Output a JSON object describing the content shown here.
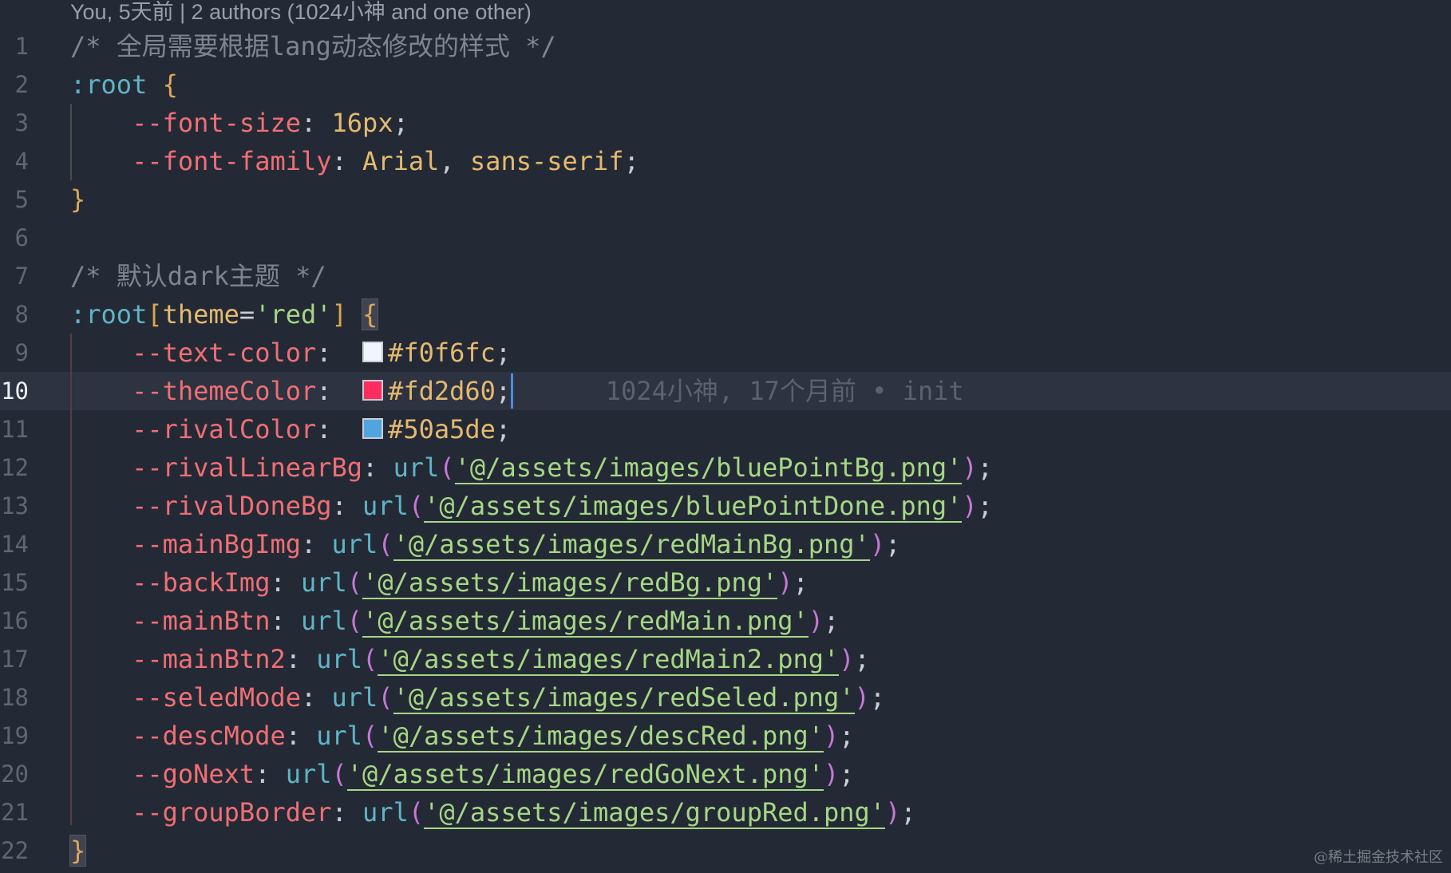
{
  "codelens": "You, 5天前 | 2 authors (1024小神 and one other)",
  "lines": [
    {
      "n": "1",
      "tokens": [
        {
          "t": "/* 全局需要根据lang动态修改的样式 */",
          "c": "com"
        }
      ]
    },
    {
      "n": "2",
      "tokens": [
        {
          "t": ":root",
          "c": "sel"
        },
        {
          "t": " ",
          "c": "op"
        },
        {
          "t": "{",
          "c": "brace"
        }
      ]
    },
    {
      "n": "3",
      "tokens": [
        {
          "t": "    ",
          "c": "op"
        },
        {
          "t": "--font-size",
          "c": "prop"
        },
        {
          "t": ": ",
          "c": "punct"
        },
        {
          "t": "16px",
          "c": "num"
        },
        {
          "t": ";",
          "c": "punct"
        }
      ]
    },
    {
      "n": "4",
      "tokens": [
        {
          "t": "    ",
          "c": "op"
        },
        {
          "t": "--font-family",
          "c": "prop"
        },
        {
          "t": ": ",
          "c": "punct"
        },
        {
          "t": "Arial",
          "c": "val"
        },
        {
          "t": ", ",
          "c": "punct"
        },
        {
          "t": "sans-serif",
          "c": "val"
        },
        {
          "t": ";",
          "c": "punct"
        }
      ]
    },
    {
      "n": "5",
      "tokens": [
        {
          "t": "}",
          "c": "brace"
        }
      ]
    },
    {
      "n": "6",
      "tokens": []
    },
    {
      "n": "7",
      "tokens": [
        {
          "t": "/* 默认dark主题 */",
          "c": "com"
        }
      ]
    },
    {
      "n": "8",
      "tokens": [
        {
          "t": ":root",
          "c": "sel"
        },
        {
          "t": "[",
          "c": "brk"
        },
        {
          "t": "theme",
          "c": "attr"
        },
        {
          "t": "=",
          "c": "op"
        },
        {
          "t": "'red'",
          "c": "str"
        },
        {
          "t": "]",
          "c": "brk"
        },
        {
          "t": " ",
          "c": "op"
        },
        {
          "t": "{",
          "c": "brace hlbrace"
        }
      ]
    },
    {
      "n": "9",
      "tokens": [
        {
          "t": "    ",
          "c": "op"
        },
        {
          "t": "--text-color",
          "c": "prop"
        },
        {
          "t": ":  ",
          "c": "punct"
        },
        {
          "swatch": "#f0f6fc"
        },
        {
          "t": "#f0f6fc",
          "c": "val"
        },
        {
          "t": ";",
          "c": "punct"
        }
      ]
    },
    {
      "n": "10",
      "current": true,
      "tokens": [
        {
          "t": "    ",
          "c": "op"
        },
        {
          "t": "--themeColor",
          "c": "prop"
        },
        {
          "t": ":  ",
          "c": "punct"
        },
        {
          "swatch": "#fd2d60"
        },
        {
          "t": "#fd2d60",
          "c": "val"
        },
        {
          "t": ";",
          "c": "punct"
        },
        {
          "cursor": true
        },
        {
          "t": "      1024小神, 17个月前 • init",
          "c": "blame"
        }
      ]
    },
    {
      "n": "11",
      "tokens": [
        {
          "t": "    ",
          "c": "op"
        },
        {
          "t": "--rivalColor",
          "c": "prop"
        },
        {
          "t": ":  ",
          "c": "punct"
        },
        {
          "swatch": "#50a5de"
        },
        {
          "t": "#50a5de",
          "c": "val"
        },
        {
          "t": ";",
          "c": "punct"
        }
      ]
    },
    {
      "n": "12",
      "tokens": [
        {
          "t": "    ",
          "c": "op"
        },
        {
          "t": "--rivalLinearBg",
          "c": "prop"
        },
        {
          "t": ": ",
          "c": "punct"
        },
        {
          "t": "url",
          "c": "fn"
        },
        {
          "t": "(",
          "c": "paren"
        },
        {
          "t": "'@/assets/images/bluePointBg.png'",
          "c": "url"
        },
        {
          "t": ")",
          "c": "paren"
        },
        {
          "t": ";",
          "c": "punct"
        }
      ]
    },
    {
      "n": "13",
      "tokens": [
        {
          "t": "    ",
          "c": "op"
        },
        {
          "t": "--rivalDoneBg",
          "c": "prop"
        },
        {
          "t": ": ",
          "c": "punct"
        },
        {
          "t": "url",
          "c": "fn"
        },
        {
          "t": "(",
          "c": "paren"
        },
        {
          "t": "'@/assets/images/bluePointDone.png'",
          "c": "url"
        },
        {
          "t": ")",
          "c": "paren"
        },
        {
          "t": ";",
          "c": "punct"
        }
      ]
    },
    {
      "n": "14",
      "tokens": [
        {
          "t": "    ",
          "c": "op"
        },
        {
          "t": "--mainBgImg",
          "c": "prop"
        },
        {
          "t": ": ",
          "c": "punct"
        },
        {
          "t": "url",
          "c": "fn"
        },
        {
          "t": "(",
          "c": "paren"
        },
        {
          "t": "'@/assets/images/redMainBg.png'",
          "c": "url"
        },
        {
          "t": ")",
          "c": "paren"
        },
        {
          "t": ";",
          "c": "punct"
        }
      ]
    },
    {
      "n": "15",
      "tokens": [
        {
          "t": "    ",
          "c": "op"
        },
        {
          "t": "--backImg",
          "c": "prop"
        },
        {
          "t": ": ",
          "c": "punct"
        },
        {
          "t": "url",
          "c": "fn"
        },
        {
          "t": "(",
          "c": "paren"
        },
        {
          "t": "'@/assets/images/redBg.png'",
          "c": "url"
        },
        {
          "t": ")",
          "c": "paren"
        },
        {
          "t": ";",
          "c": "punct"
        }
      ]
    },
    {
      "n": "16",
      "tokens": [
        {
          "t": "    ",
          "c": "op"
        },
        {
          "t": "--mainBtn",
          "c": "prop"
        },
        {
          "t": ": ",
          "c": "punct"
        },
        {
          "t": "url",
          "c": "fn"
        },
        {
          "t": "(",
          "c": "paren"
        },
        {
          "t": "'@/assets/images/redMain.png'",
          "c": "url"
        },
        {
          "t": ")",
          "c": "paren"
        },
        {
          "t": ";",
          "c": "punct"
        }
      ]
    },
    {
      "n": "17",
      "tokens": [
        {
          "t": "    ",
          "c": "op"
        },
        {
          "t": "--mainBtn2",
          "c": "prop"
        },
        {
          "t": ": ",
          "c": "punct"
        },
        {
          "t": "url",
          "c": "fn"
        },
        {
          "t": "(",
          "c": "paren"
        },
        {
          "t": "'@/assets/images/redMain2.png'",
          "c": "url"
        },
        {
          "t": ")",
          "c": "paren"
        },
        {
          "t": ";",
          "c": "punct"
        }
      ]
    },
    {
      "n": "18",
      "tokens": [
        {
          "t": "    ",
          "c": "op"
        },
        {
          "t": "--seledMode",
          "c": "prop"
        },
        {
          "t": ": ",
          "c": "punct"
        },
        {
          "t": "url",
          "c": "fn"
        },
        {
          "t": "(",
          "c": "paren"
        },
        {
          "t": "'@/assets/images/redSeled.png'",
          "c": "url"
        },
        {
          "t": ")",
          "c": "paren"
        },
        {
          "t": ";",
          "c": "punct"
        }
      ]
    },
    {
      "n": "19",
      "tokens": [
        {
          "t": "    ",
          "c": "op"
        },
        {
          "t": "--descMode",
          "c": "prop"
        },
        {
          "t": ": ",
          "c": "punct"
        },
        {
          "t": "url",
          "c": "fn"
        },
        {
          "t": "(",
          "c": "paren"
        },
        {
          "t": "'@/assets/images/descRed.png'",
          "c": "url"
        },
        {
          "t": ")",
          "c": "paren"
        },
        {
          "t": ";",
          "c": "punct"
        }
      ]
    },
    {
      "n": "20",
      "tokens": [
        {
          "t": "    ",
          "c": "op"
        },
        {
          "t": "--goNext",
          "c": "prop"
        },
        {
          "t": ": ",
          "c": "punct"
        },
        {
          "t": "url",
          "c": "fn"
        },
        {
          "t": "(",
          "c": "paren"
        },
        {
          "t": "'@/assets/images/redGoNext.png'",
          "c": "url"
        },
        {
          "t": ")",
          "c": "paren"
        },
        {
          "t": ";",
          "c": "punct"
        }
      ]
    },
    {
      "n": "21",
      "tokens": [
        {
          "t": "    ",
          "c": "op"
        },
        {
          "t": "--groupBorder",
          "c": "prop"
        },
        {
          "t": ": ",
          "c": "punct"
        },
        {
          "t": "url",
          "c": "fn"
        },
        {
          "t": "(",
          "c": "paren"
        },
        {
          "t": "'@/assets/images/groupRed.png'",
          "c": "url"
        },
        {
          "t": ")",
          "c": "paren"
        },
        {
          "t": ";",
          "c": "punct"
        }
      ]
    },
    {
      "n": "22",
      "tokens": [
        {
          "t": "}",
          "c": "brace hlbrace"
        }
      ]
    }
  ],
  "watermark": "@稀土掘金技术社区",
  "colors": {
    "background": "#242a35",
    "current_line": "#2d3340",
    "cursor": "#4b8ce6"
  }
}
